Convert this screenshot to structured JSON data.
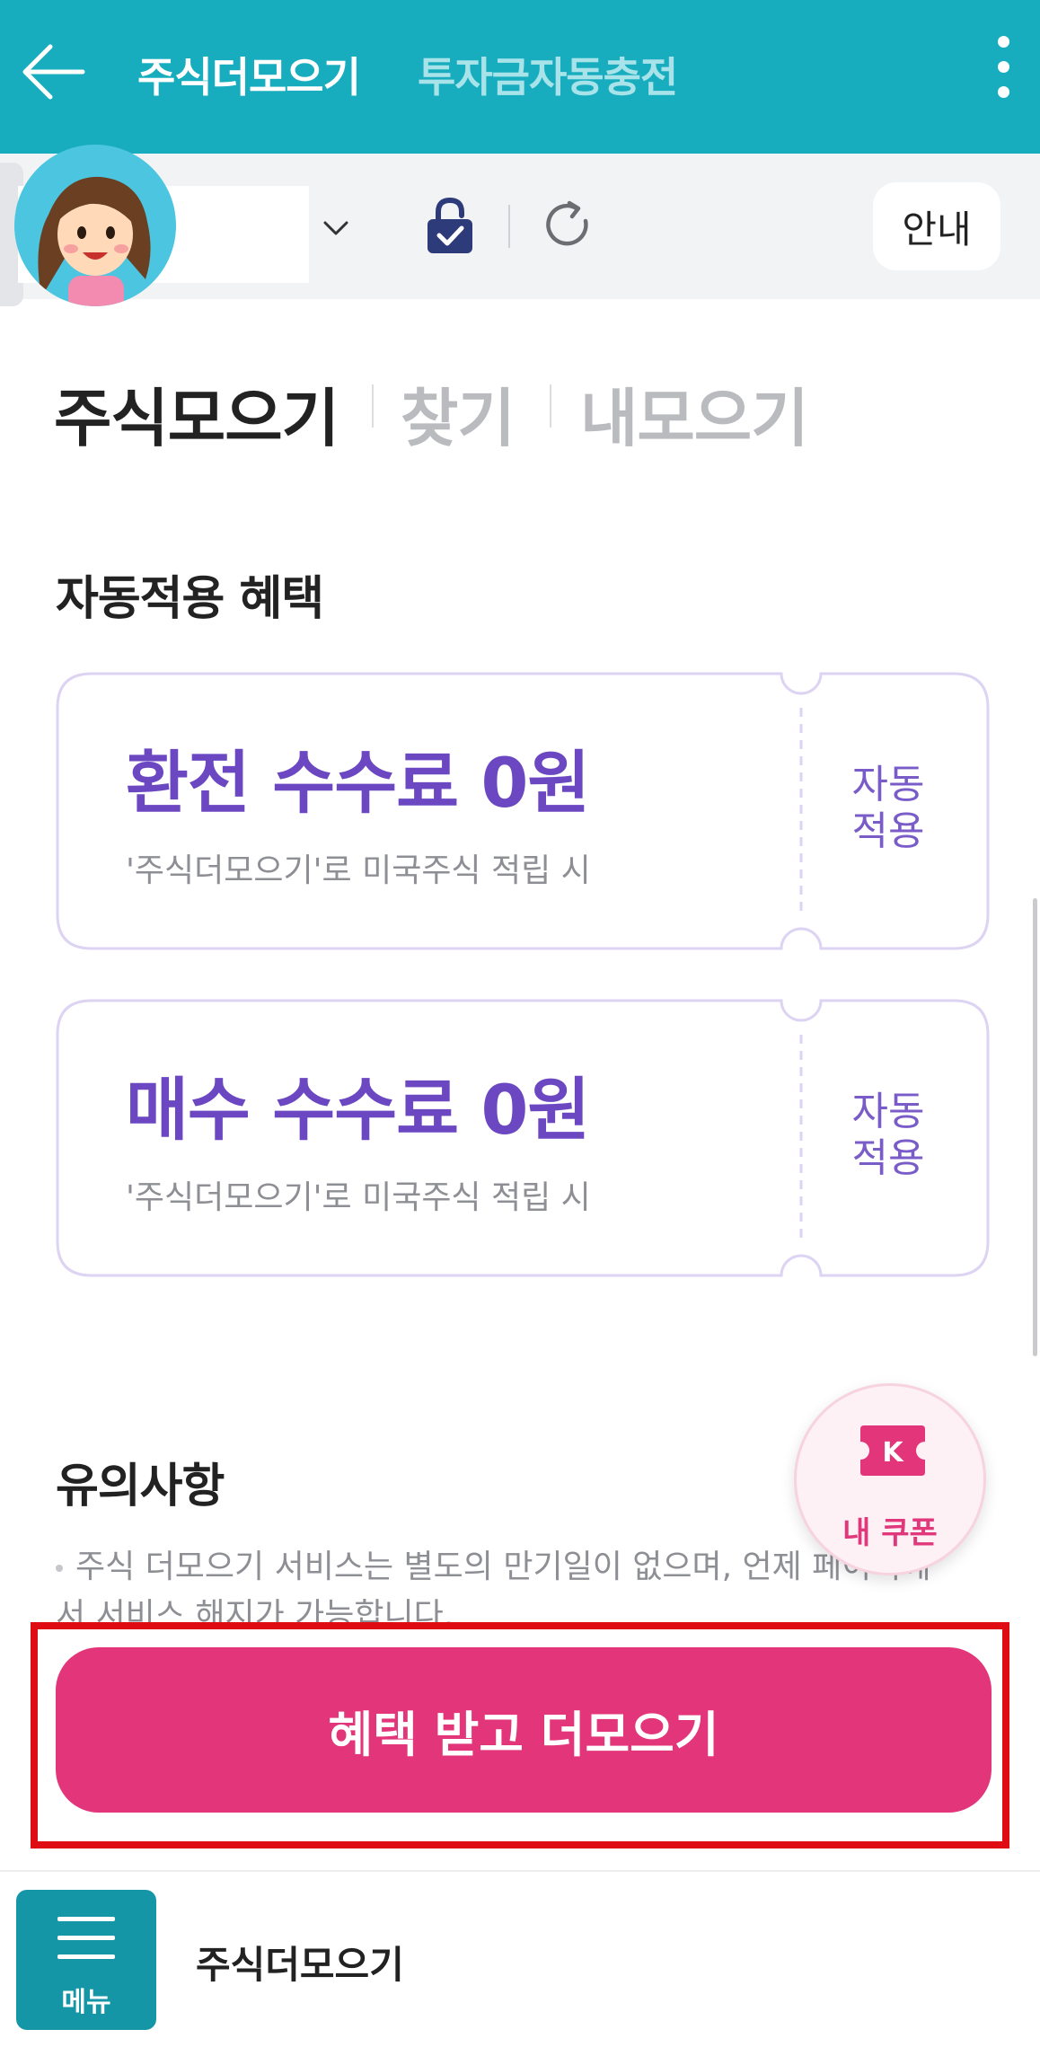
{
  "header": {
    "tabs": [
      {
        "label": "주식더모으기",
        "active": true
      },
      {
        "label": "투자금자동충전",
        "active": false
      }
    ],
    "back_icon": "arrow-left",
    "more_icon": "vertical-ellipsis"
  },
  "account_bar": {
    "info_button": "안내",
    "icons": [
      "dropdown-chevron",
      "lock-check",
      "refresh"
    ]
  },
  "sub_tabs": [
    {
      "label": "주식모으기",
      "active": true
    },
    {
      "label": "찾기",
      "active": false
    },
    {
      "label": "내모으기",
      "active": false
    }
  ],
  "benefits": {
    "title": "자동적용 혜택",
    "coupons": [
      {
        "title": "환전 수수료 0원",
        "subtitle": "'주식더모으기'로 미국주식 적립 시",
        "badge_line1": "자동",
        "badge_line2": "적용"
      },
      {
        "title": "매수 수수료 0원",
        "subtitle": "'주식더모으기'로 미국주식 적립 시",
        "badge_line1": "자동",
        "badge_line2": "적용"
      }
    ]
  },
  "notes": {
    "title": "유의사항",
    "items": [
      "주식 더모으기 서비스는 별도의 만기일이 없으며, 언제 페이지에서 서비스 해지가 가능합니다."
    ]
  },
  "coupon_fab": {
    "label": "내 쿠폰",
    "icon": "ticket-k"
  },
  "cta": {
    "label": "혜택 받고 더모으기"
  },
  "bottom_bar": {
    "menu_label": "메뉴",
    "title": "주식더모으기"
  },
  "colors": {
    "header": "#17adbe",
    "accent_purple": "#6b47c2",
    "cta_pink": "#e3357a",
    "highlight_red": "#e00c14",
    "menu_teal": "#1596a6"
  }
}
